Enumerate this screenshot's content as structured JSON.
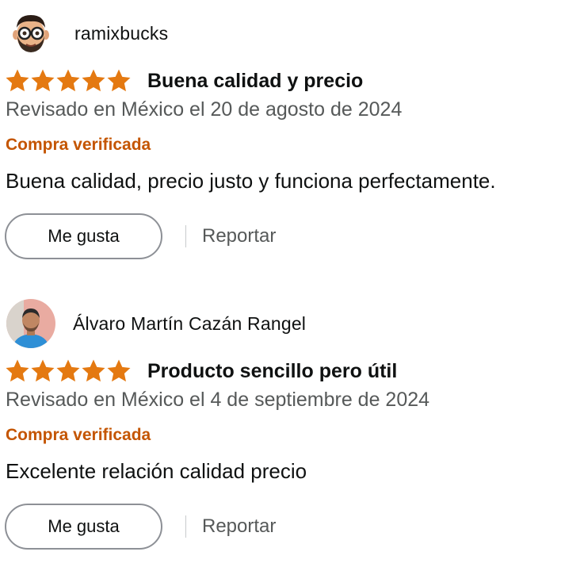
{
  "colors": {
    "star": "#e47911",
    "verified": "#c45500",
    "meta_text": "#565959",
    "text": "#0f1111",
    "button_border": "#8d9096"
  },
  "reviews": [
    {
      "author": "ramixbucks",
      "avatar_icon": "cartoon-face-with-glasses-icon",
      "rating": 5,
      "rating_max": 5,
      "title": "Buena calidad y precio",
      "date": "Revisado en México el 20 de agosto de 2024",
      "verified_label": "Compra verificada",
      "body": "Buena calidad, precio justo y funciona perfectamente.",
      "helpful_label": "Me gusta",
      "report_label": "Reportar"
    },
    {
      "author": "Álvaro Martín Cazán Rangel",
      "avatar_icon": "user-photo-icon",
      "rating": 5,
      "rating_max": 5,
      "title": "Producto sencillo pero útil",
      "date": "Revisado en México el 4 de septiembre de 2024",
      "verified_label": "Compra verificada",
      "body": "Excelente relación calidad precio",
      "helpful_label": "Me gusta",
      "report_label": "Reportar"
    }
  ]
}
